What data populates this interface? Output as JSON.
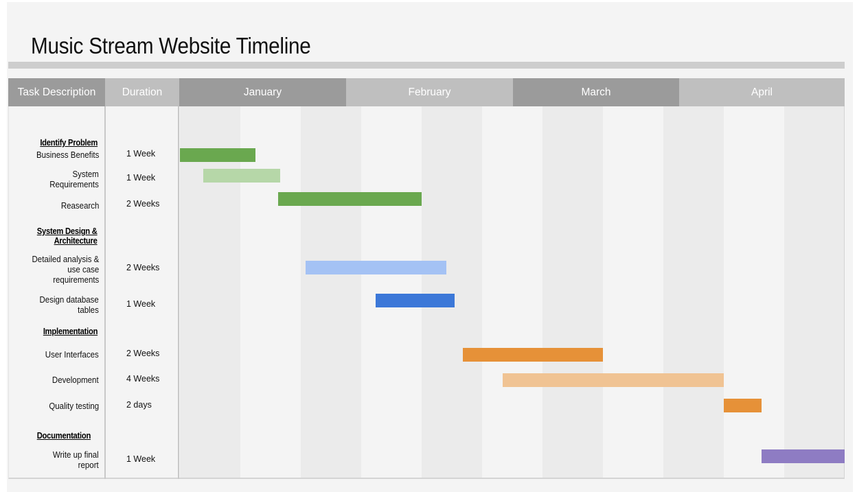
{
  "title": "Music Stream Website Timeline",
  "header": {
    "task_description": "Task Description",
    "duration": "Duration",
    "months": [
      "January",
      "February",
      "March",
      "April"
    ]
  },
  "colors": {
    "header_dark": "#9b9b9b",
    "header_light": "#bfbfbf",
    "green": "#6aa84f",
    "green_light": "#b6d7a8",
    "blue": "#3c78d8",
    "blue_light": "#a4c2f4",
    "orange": "#e69138",
    "orange_light": "#f0c393",
    "purple": "#8e7cc3"
  },
  "sections": [
    {
      "name": "Identify Problem"
    },
    {
      "name": "System Design &\nArchitecture"
    },
    {
      "name": "Implementation"
    },
    {
      "name": "Documentation"
    }
  ],
  "chart_data": {
    "type": "gantt",
    "title": "Music Stream Website Timeline",
    "time_axis": {
      "unit": "week",
      "range": [
        0,
        11
      ],
      "months": [
        {
          "name": "January",
          "start": 0,
          "end": 2.75
        },
        {
          "name": "February",
          "start": 2.75,
          "end": 5.5
        },
        {
          "name": "March",
          "start": 5.5,
          "end": 8.25
        },
        {
          "name": "April",
          "start": 8.25,
          "end": 11
        }
      ]
    },
    "tasks": [
      {
        "section": "Identify Problem",
        "task": "Business Benefits",
        "duration": "1 Week",
        "start": 0.0,
        "end": 1.25,
        "color": "#6aa84f"
      },
      {
        "section": "Identify Problem",
        "task": "System\nRequirements",
        "duration": "1 Week",
        "start": 0.39,
        "end": 1.66,
        "color": "#b6d7a8"
      },
      {
        "section": "Identify Problem",
        "task": "Reasearch",
        "duration": "2 Weeks",
        "start": 1.63,
        "end": 4.0,
        "color": "#6aa84f"
      },
      {
        "section": "System Design & Architecture",
        "task": "Detailed analysis &\nuse case\nrequirements",
        "duration": "2 Weeks",
        "start": 2.08,
        "end": 4.41,
        "color": "#a4c2f4"
      },
      {
        "section": "System Design & Architecture",
        "task": "Design database\ntables",
        "duration": "1 Week",
        "start": 3.24,
        "end": 4.55,
        "color": "#3c78d8"
      },
      {
        "section": "Implementation",
        "task": "User Interfaces",
        "duration": "2 Weeks",
        "start": 4.68,
        "end": 7.0,
        "color": "#e69138"
      },
      {
        "section": "Implementation",
        "task": "Development",
        "duration": "4 Weeks",
        "start": 5.34,
        "end": 9.0,
        "color": "#f0c393"
      },
      {
        "section": "Implementation",
        "task": "Quality testing",
        "duration": "2 days",
        "start": 9.0,
        "end": 9.62,
        "color": "#e69138"
      },
      {
        "section": "Documentation",
        "task": "Write up final\nreport",
        "duration": "1 Week",
        "start": 9.62,
        "end": 11.0,
        "color": "#8e7cc3"
      }
    ]
  }
}
